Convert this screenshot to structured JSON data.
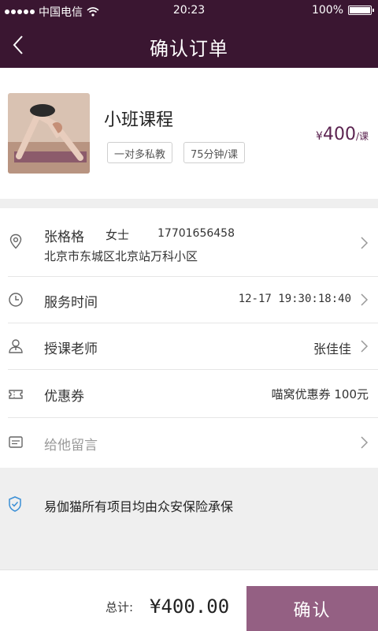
{
  "status": {
    "carrier": "中国电信",
    "time": "20:23",
    "battery": "100%"
  },
  "nav": {
    "title": "确认订单"
  },
  "product": {
    "name": "小班课程",
    "tags": [
      "一对多私教",
      "75分钟/课"
    ],
    "price_currency": "¥",
    "price_value": "400",
    "price_unit": "/课"
  },
  "contact": {
    "name": "张格格",
    "title": "女士",
    "phone": "17701656458",
    "address": "北京市东城区北京站万科小区"
  },
  "service_time": {
    "label": "服务时间",
    "value": "12-17 19:30:18:40"
  },
  "teacher": {
    "label": "授课老师",
    "value": "张佳佳"
  },
  "coupon": {
    "label": "优惠券",
    "value": "喵窝优惠券 100元"
  },
  "message": {
    "placeholder": "给他留言"
  },
  "insurance": {
    "text": "易伽猫所有项目均由众安保险承保"
  },
  "footer": {
    "total_label": "总计:",
    "total_amount": "¥400.00",
    "confirm_label": "确认"
  },
  "colors": {
    "header": "#3a1631",
    "accent": "#5b2350",
    "button": "#946083"
  }
}
